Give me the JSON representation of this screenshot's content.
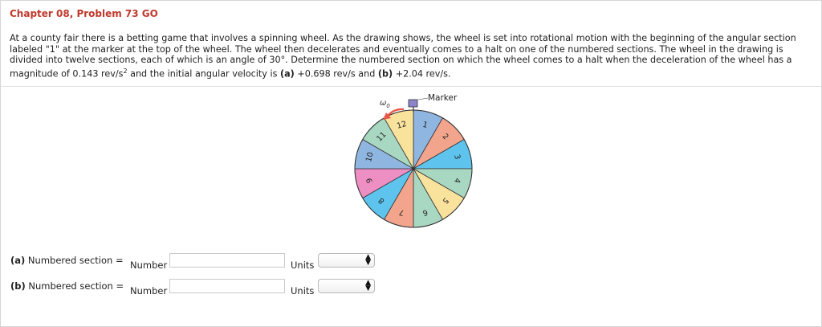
{
  "header": {
    "title": "Chapter 08, Problem 73 GO"
  },
  "problem": {
    "text_part1": "At a county fair there is a betting game that involves a spinning wheel. As the drawing shows, the wheel is set into rotational motion with the beginning of the angular section labeled \"1\" at the marker at the top of the wheel. The wheel then decelerates and eventually comes to a halt on one of the numbered sections. The wheel in the drawing is divided into twelve sections, each of which is an angle of 30°. Determine the numbered section on which the wheel comes to a halt when the deceleration of the wheel has a magnitude of 0.143 rev/s",
    "text_sup": "2",
    "text_part2": " and the initial angular velocity is ",
    "part_a_tag": "(a)",
    "part_a_value": " +0.698 rev/s and ",
    "part_b_tag": "(b)",
    "part_b_value": " +2.04 rev/s."
  },
  "figure": {
    "marker_label": "Marker",
    "omega_symbol": "ω",
    "omega_subscript": "0",
    "sections": [
      {
        "label": "1",
        "color": "#8fb6e0"
      },
      {
        "label": "2",
        "color": "#f2a58c"
      },
      {
        "label": "3",
        "color": "#5ec4ee"
      },
      {
        "label": "4",
        "color": "#a9d8c2"
      },
      {
        "label": "5",
        "color": "#f9e29c"
      },
      {
        "label": "6",
        "color": "#a9d8c2"
      },
      {
        "label": "7",
        "color": "#f2a58c"
      },
      {
        "label": "8",
        "color": "#5ec4ee"
      },
      {
        "label": "9",
        "color": "#ee8fc4"
      },
      {
        "label": "10",
        "color": "#8fb6e0"
      },
      {
        "label": "11",
        "color": "#a9d8c2"
      },
      {
        "label": "12",
        "color": "#f9e29c"
      }
    ],
    "arrow_color": "#e8574a",
    "marker_color": "#8d83c9"
  },
  "answers": [
    {
      "part": "(a)",
      "label": " Numbered section =",
      "number_label": "Number",
      "number_value": "",
      "units_label": "Units",
      "units_value": ""
    },
    {
      "part": "(b)",
      "label": " Numbered section =",
      "number_label": "Number",
      "number_value": "",
      "units_label": "Units",
      "units_value": ""
    }
  ]
}
